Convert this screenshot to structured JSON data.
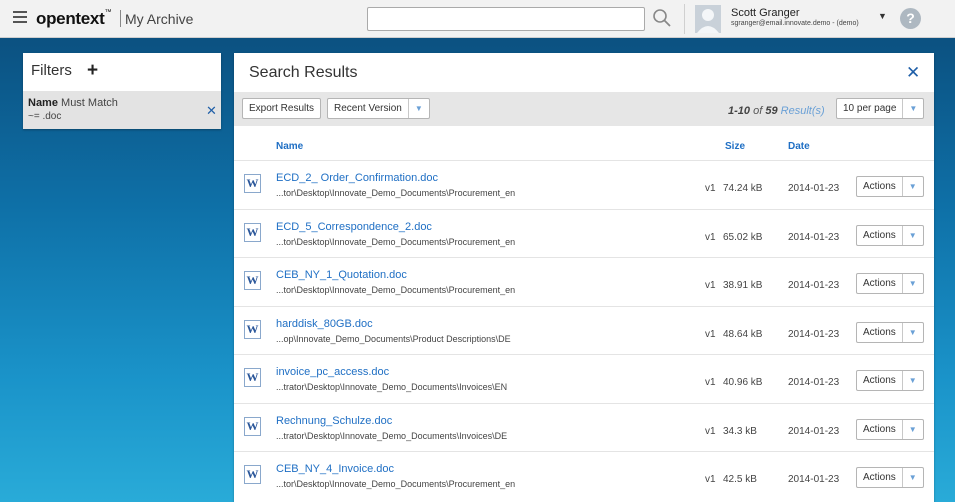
{
  "header": {
    "logo": "opentext",
    "logo_tm": "™",
    "app_title": "My Archive",
    "search": {
      "value": "",
      "placeholder": ""
    },
    "user": {
      "name": "Scott Granger",
      "email": "sgranger@email.innovate.demo - (demo)"
    }
  },
  "filters": {
    "title": "Filters",
    "add": "+",
    "items": [
      {
        "label": "Name",
        "operator": "Must Match",
        "value": "~= .doc"
      }
    ]
  },
  "results": {
    "title": "Search Results",
    "export_label": "Export Results",
    "version_label": "Recent Version",
    "range": "1-10",
    "of_word": "of",
    "total": "59",
    "result_word": "Result(s)",
    "per_page": "10 per page",
    "columns": {
      "name": "Name",
      "size": "Size",
      "date": "Date"
    },
    "action_label": "Actions",
    "rows": [
      {
        "name": "ECD_2_ Order_Confirmation.doc",
        "path": "...tor\\Desktop\\Innovate_Demo_Documents\\Procurement_en",
        "version": "v1",
        "size": "74.24 kB",
        "date": "2014-01-23"
      },
      {
        "name": "ECD_5_Correspondence_2.doc",
        "path": "...tor\\Desktop\\Innovate_Demo_Documents\\Procurement_en",
        "version": "v1",
        "size": "65.02 kB",
        "date": "2014-01-23"
      },
      {
        "name": "CEB_NY_1_Quotation.doc",
        "path": "...tor\\Desktop\\Innovate_Demo_Documents\\Procurement_en",
        "version": "v1",
        "size": "38.91 kB",
        "date": "2014-01-23"
      },
      {
        "name": "harddisk_80GB.doc",
        "path": "...op\\Innovate_Demo_Documents\\Product Descriptions\\DE",
        "version": "v1",
        "size": "48.64 kB",
        "date": "2014-01-23"
      },
      {
        "name": "invoice_pc_access.doc",
        "path": "...trator\\Desktop\\Innovate_Demo_Documents\\Invoices\\EN",
        "version": "v1",
        "size": "40.96 kB",
        "date": "2014-01-23"
      },
      {
        "name": "Rechnung_Schulze.doc",
        "path": "...trator\\Desktop\\Innovate_Demo_Documents\\Invoices\\DE",
        "version": "v1",
        "size": "34.3 kB",
        "date": "2014-01-23"
      },
      {
        "name": "CEB_NY_4_Invoice.doc",
        "path": "...tor\\Desktop\\Innovate_Demo_Documents\\Procurement_en",
        "version": "v1",
        "size": "42.5 kB",
        "date": "2014-01-23"
      }
    ]
  },
  "colors": {
    "accent": "#1f6fc4",
    "bg_top": "#0b4a78",
    "bg_bottom": "#29abd8"
  },
  "icons": [
    "menu-icon",
    "search-icon",
    "avatar",
    "chevron-down-icon",
    "help-icon",
    "plus-icon",
    "close-icon",
    "word-doc-icon"
  ]
}
